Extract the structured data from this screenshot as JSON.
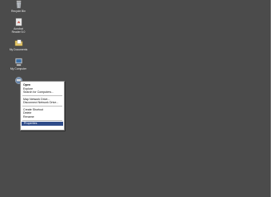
{
  "desktop": {
    "icons": [
      {
        "id": "recycle-bin",
        "label": "Recycle Bin",
        "icon": "recycle-bin-icon"
      },
      {
        "id": "acrobat",
        "label": "Acrobat\nReader 5.0",
        "icon": "acrobat-reader-icon"
      },
      {
        "id": "my-documents",
        "label": "My Documents",
        "icon": "my-documents-icon"
      },
      {
        "id": "my-computer",
        "label": "My Computer",
        "icon": "my-computer-icon"
      }
    ]
  },
  "context_menu": {
    "items": [
      {
        "label": "Open",
        "bold": true
      },
      {
        "label": "Explore"
      },
      {
        "label": "Search for Computers..."
      },
      {
        "separator": true
      },
      {
        "label": "Map Network Drive..."
      },
      {
        "label": "Disconnect Network Drive..."
      },
      {
        "separator": true
      },
      {
        "label": "Create Shortcut"
      },
      {
        "label": "Delete"
      },
      {
        "label": "Rename"
      },
      {
        "separator": true
      },
      {
        "label": "Properties",
        "highlighted": true
      }
    ]
  },
  "colors": {
    "desktop_bg": "#4b4b4b",
    "menu_highlight": "#2f4c8a"
  }
}
